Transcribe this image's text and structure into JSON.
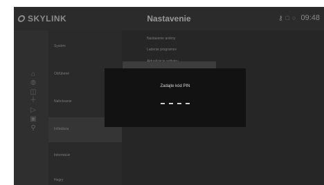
{
  "header": {
    "brand": "SKYLINK",
    "title": "Nastavenie",
    "clock": "09:48",
    "status_icons": [
      "key-icon",
      "stop-icon",
      "record-icon"
    ]
  },
  "rail_icons": [
    "home-icon",
    "compass-icon",
    "catchup-icon",
    "plus-icon",
    "play-icon",
    "tv-icon",
    "search-icon"
  ],
  "menu": {
    "items": [
      {
        "label": "Systém",
        "selected": false
      },
      {
        "label": "Obľúbené",
        "selected": false
      },
      {
        "label": "Nahrávanie",
        "selected": false
      },
      {
        "label": "Inštalácia",
        "selected": true
      },
      {
        "label": "Informácie",
        "selected": false
      },
      {
        "label": "Hegry",
        "selected": false
      }
    ]
  },
  "content": {
    "items": [
      "Nastavenie antény",
      "Ladenie programov",
      "Aktualizácia softvéru"
    ]
  },
  "dialog": {
    "title": "Zadajte kód PIN",
    "pin_slots": 4
  },
  "colors": {
    "accent": "#c0623a",
    "background": "#262626",
    "dialog": "#121212"
  }
}
